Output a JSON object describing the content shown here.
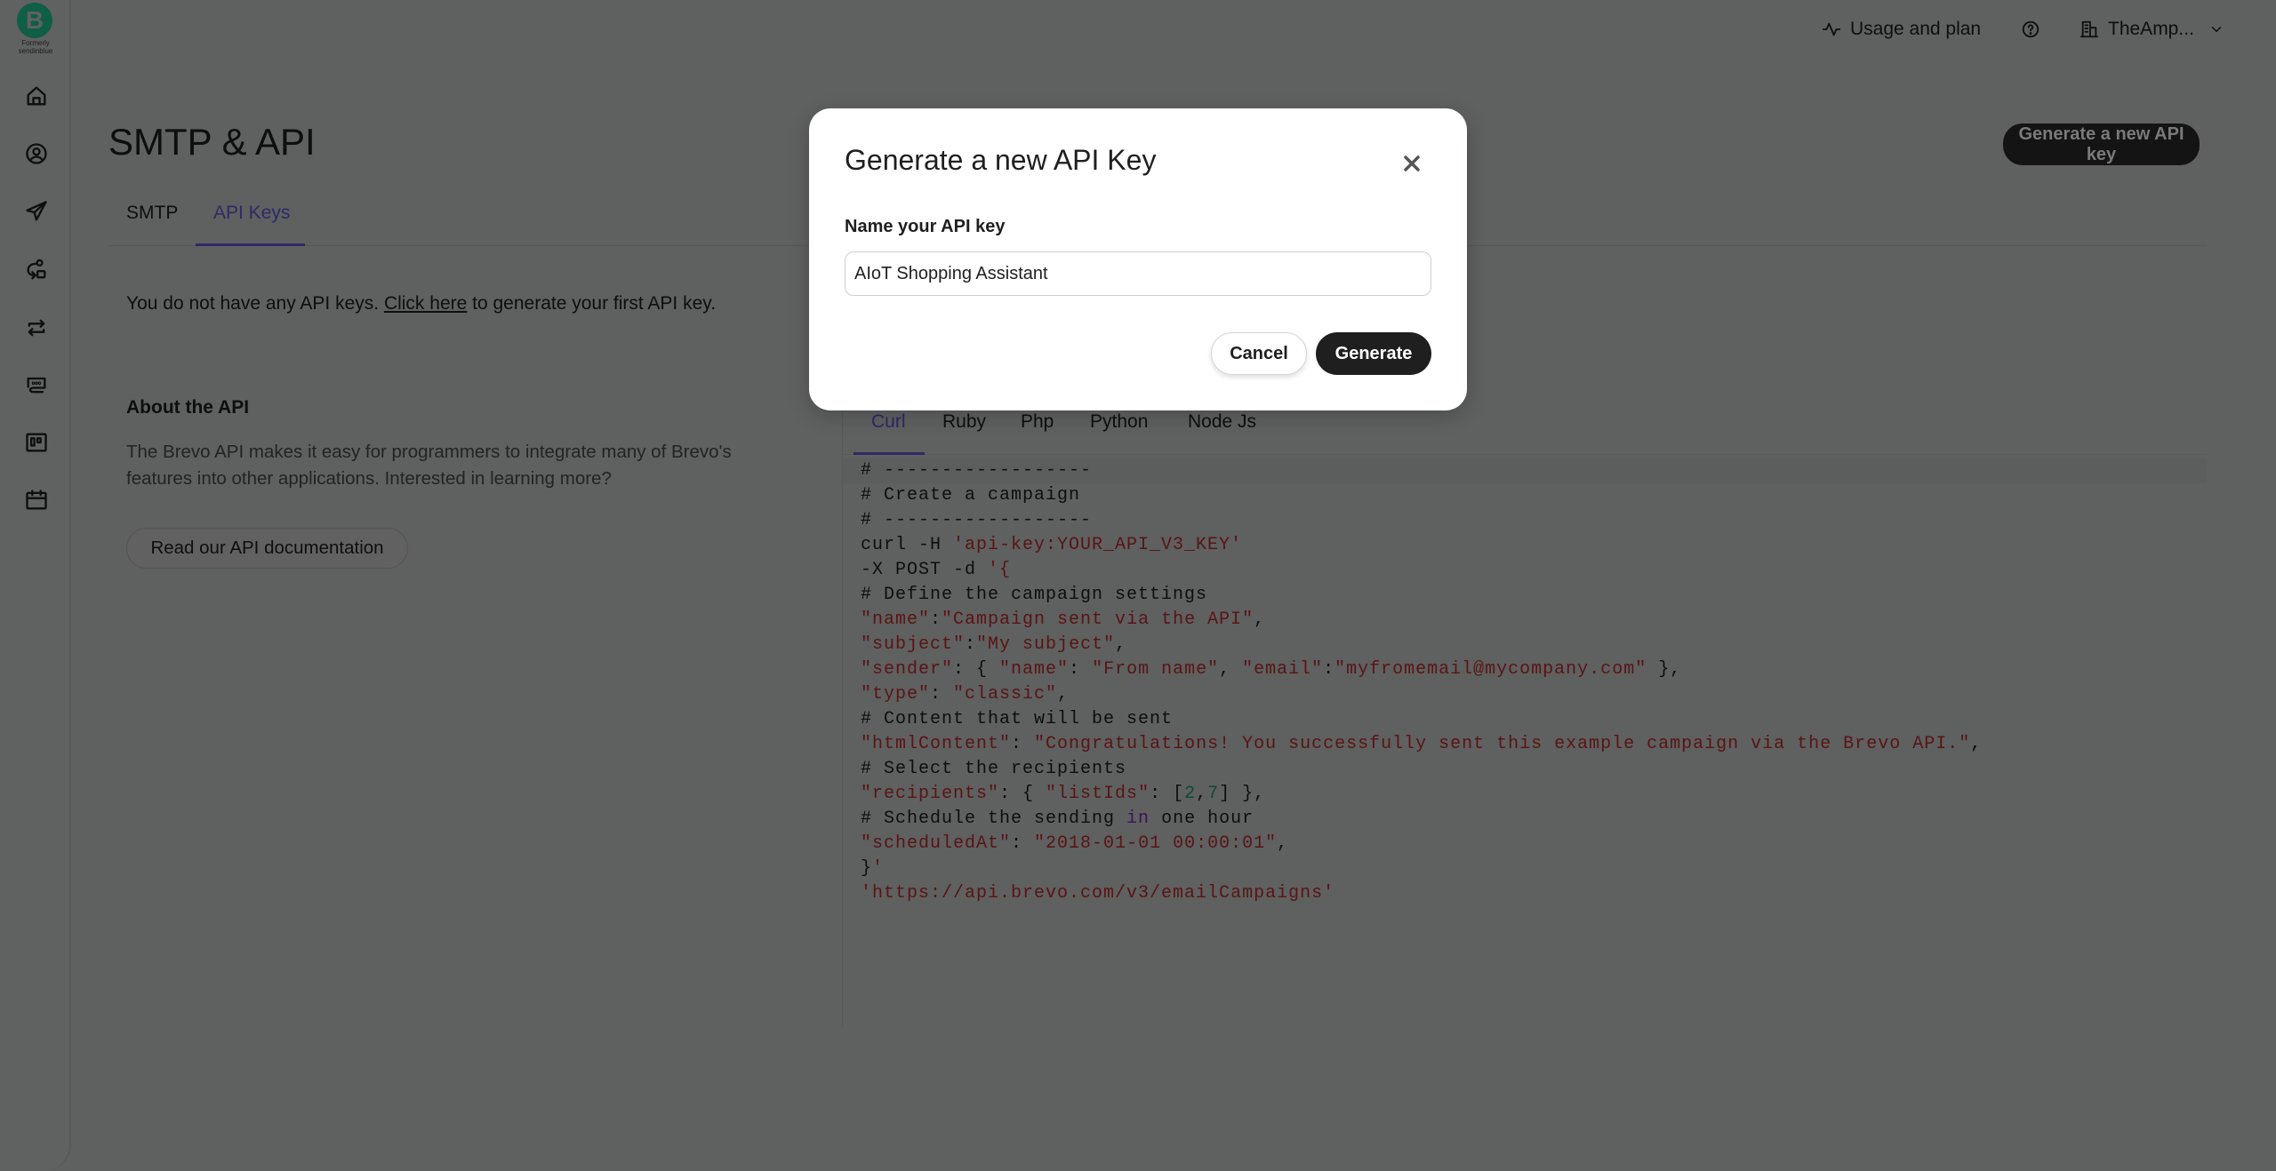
{
  "brand": {
    "logo_letter": "B",
    "logo_subtitle": "Formerly sendinblue",
    "color": "#0b996e"
  },
  "sidebar": {
    "items": [
      {
        "icon": "home-icon"
      },
      {
        "icon": "contacts-icon"
      },
      {
        "icon": "campaigns-send-icon"
      },
      {
        "icon": "automation-icon"
      },
      {
        "icon": "transactional-icon"
      },
      {
        "icon": "conversations-icon"
      },
      {
        "icon": "deals-board-icon"
      },
      {
        "icon": "calendar-icon"
      }
    ]
  },
  "header": {
    "usage_label": "Usage and plan",
    "org_label": "TheAmp..."
  },
  "page": {
    "title": "SMTP & API",
    "generate_button": "Generate a new API key",
    "tabs": [
      {
        "label": "SMTP",
        "active": false
      },
      {
        "label": "API Keys",
        "active": true
      }
    ],
    "empty_message": {
      "before": "You do not have any API keys. ",
      "link": "Click here",
      "after": " to generate your first API key."
    },
    "about": {
      "title": "About the API",
      "text": "The Brevo API makes it easy for programmers to integrate many of Brevo's features into other applications. Interested in learning more?",
      "doc_button": "Read our API documentation"
    }
  },
  "code_sample": {
    "tabs": [
      {
        "label": "Curl",
        "active": true
      },
      {
        "label": "Ruby",
        "active": false
      },
      {
        "label": "Php",
        "active": false
      },
      {
        "label": "Python",
        "active": false
      },
      {
        "label": "Node Js",
        "active": false
      }
    ],
    "lines": [
      [
        {
          "t": "# ------------------",
          "k": "c"
        }
      ],
      [
        {
          "t": "# Create a campaign",
          "k": "c"
        }
      ],
      [
        {
          "t": "# ------------------",
          "k": "c"
        }
      ],
      [
        {
          "t": "curl -H ",
          "k": "p"
        },
        {
          "t": "'api-key:YOUR_API_V3_KEY'",
          "k": "s"
        }
      ],
      [
        {
          "t": "-X POST -d ",
          "k": "p"
        },
        {
          "t": "'{",
          "k": "s"
        }
      ],
      [
        {
          "t": "# Define the campaign settings",
          "k": "c"
        }
      ],
      [
        {
          "t": "\"name\"",
          "k": "s"
        },
        {
          "t": ":",
          "k": "p"
        },
        {
          "t": "\"Campaign sent via the API\"",
          "k": "s"
        },
        {
          "t": ",",
          "k": "p"
        }
      ],
      [
        {
          "t": "\"subject\"",
          "k": "s"
        },
        {
          "t": ":",
          "k": "p"
        },
        {
          "t": "\"My subject\"",
          "k": "s"
        },
        {
          "t": ",",
          "k": "p"
        }
      ],
      [
        {
          "t": "\"sender\"",
          "k": "s"
        },
        {
          "t": ": { ",
          "k": "p"
        },
        {
          "t": "\"name\"",
          "k": "s"
        },
        {
          "t": ": ",
          "k": "p"
        },
        {
          "t": "\"From name\"",
          "k": "s"
        },
        {
          "t": ", ",
          "k": "p"
        },
        {
          "t": "\"email\"",
          "k": "s"
        },
        {
          "t": ":",
          "k": "p"
        },
        {
          "t": "\"myfromemail@mycompany.com\"",
          "k": "s"
        },
        {
          "t": " },",
          "k": "p"
        }
      ],
      [
        {
          "t": "\"type\"",
          "k": "s"
        },
        {
          "t": ": ",
          "k": "p"
        },
        {
          "t": "\"classic\"",
          "k": "s"
        },
        {
          "t": ",",
          "k": "p"
        }
      ],
      [
        {
          "t": "# Content that will be sent",
          "k": "c"
        }
      ],
      [
        {
          "t": "\"htmlContent\"",
          "k": "s"
        },
        {
          "t": ": ",
          "k": "p"
        },
        {
          "t": "\"Congratulations! You successfully sent this example campaign via the Brevo API.\"",
          "k": "s"
        },
        {
          "t": ",",
          "k": "p"
        }
      ],
      [
        {
          "t": "# Select the recipients",
          "k": "c"
        }
      ],
      [
        {
          "t": "\"recipients\"",
          "k": "s"
        },
        {
          "t": ": { ",
          "k": "p"
        },
        {
          "t": "\"listIds\"",
          "k": "s"
        },
        {
          "t": ": [",
          "k": "p"
        },
        {
          "t": "2",
          "k": "n"
        },
        {
          "t": ",",
          "k": "p"
        },
        {
          "t": "7",
          "k": "n"
        },
        {
          "t": "] },",
          "k": "p"
        }
      ],
      [
        {
          "t": "# Schedule the sending ",
          "k": "c"
        },
        {
          "t": "in",
          "k": "k"
        },
        {
          "t": " one hour",
          "k": "c"
        }
      ],
      [
        {
          "t": "\"scheduledAt\"",
          "k": "s"
        },
        {
          "t": ": ",
          "k": "p"
        },
        {
          "t": "\"2018-01-01 00:00:01\"",
          "k": "s"
        },
        {
          "t": ",",
          "k": "p"
        }
      ],
      [
        {
          "t": "}",
          "k": "p"
        },
        {
          "t": "'",
          "k": "s"
        }
      ],
      [
        {
          "t": "'https://api.brevo.com/v3/emailCampaigns'",
          "k": "s"
        }
      ]
    ]
  },
  "modal": {
    "title": "Generate a new API Key",
    "field_label": "Name your API key",
    "field_value": "AIoT Shopping Assistant",
    "cancel_label": "Cancel",
    "generate_label": "Generate"
  },
  "colors": {
    "accent": "#3a36a8",
    "primary_button": "#1f1f1f",
    "code_string": "#a31515",
    "code_number": "#098658"
  }
}
